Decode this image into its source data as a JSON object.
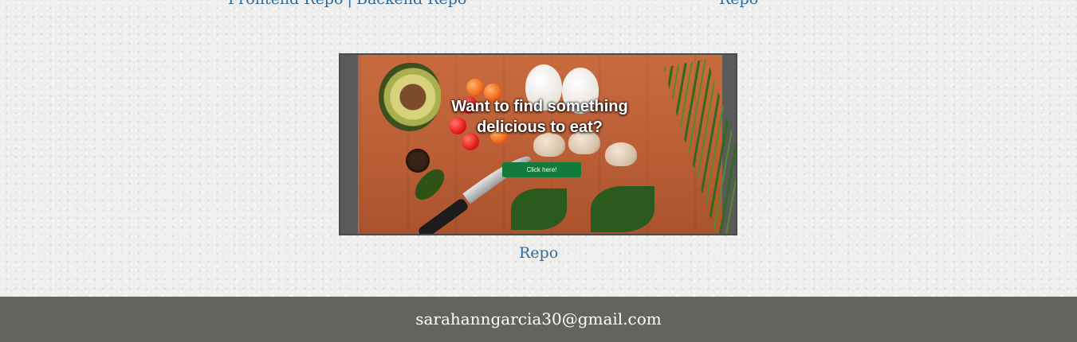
{
  "top_links": {
    "frontend_repo": "Frontend Repo",
    "separator": "|",
    "backend_repo": "Backend Repo",
    "right_repo": "Repo"
  },
  "project": {
    "image_heading": "Want to find something delicious to eat?",
    "image_button": "Click here!",
    "repo_link": "Repo"
  },
  "footer": {
    "email": "sarahanngarcia30@gmail.com"
  },
  "colors": {
    "link": "#2e6b9c",
    "footer_bg": "#64645f",
    "button_green": "#127a3a"
  }
}
